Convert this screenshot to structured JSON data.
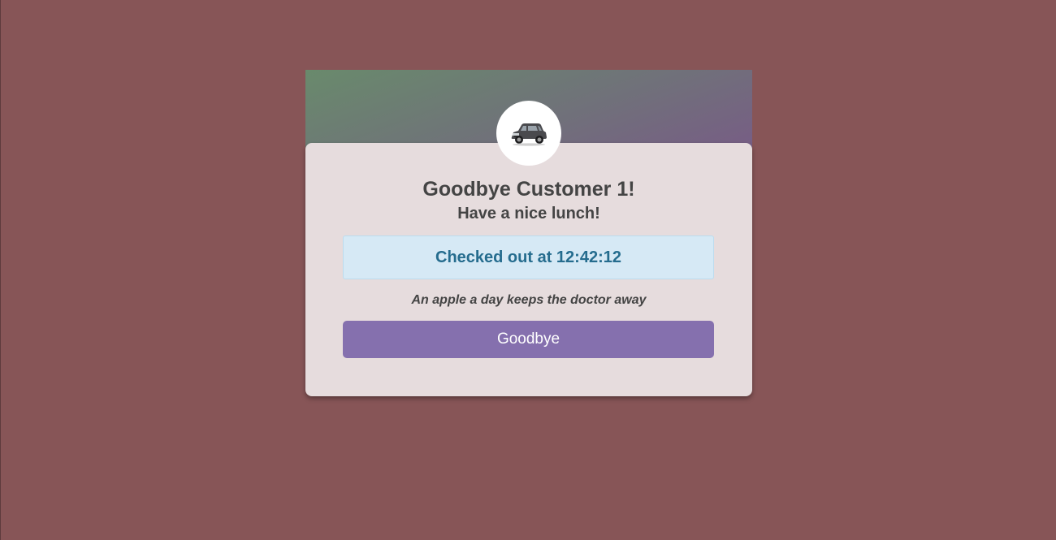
{
  "avatar": {
    "icon": "car-icon"
  },
  "greeting": {
    "title": "Goodbye Customer 1!",
    "subtitle": "Have a nice lunch!"
  },
  "status": {
    "message": "Checked out at 12:42:12"
  },
  "quote": "An apple a day keeps the doctor away",
  "actions": {
    "goodbye_label": "Goodbye"
  },
  "colors": {
    "background": "#875557",
    "card": "#e6dcdd",
    "alert_bg": "#d6e9f5",
    "alert_text": "#256c8e",
    "button": "#8570ae",
    "header_gradient_start": "#698a6c",
    "header_gradient_end": "#775d85"
  }
}
